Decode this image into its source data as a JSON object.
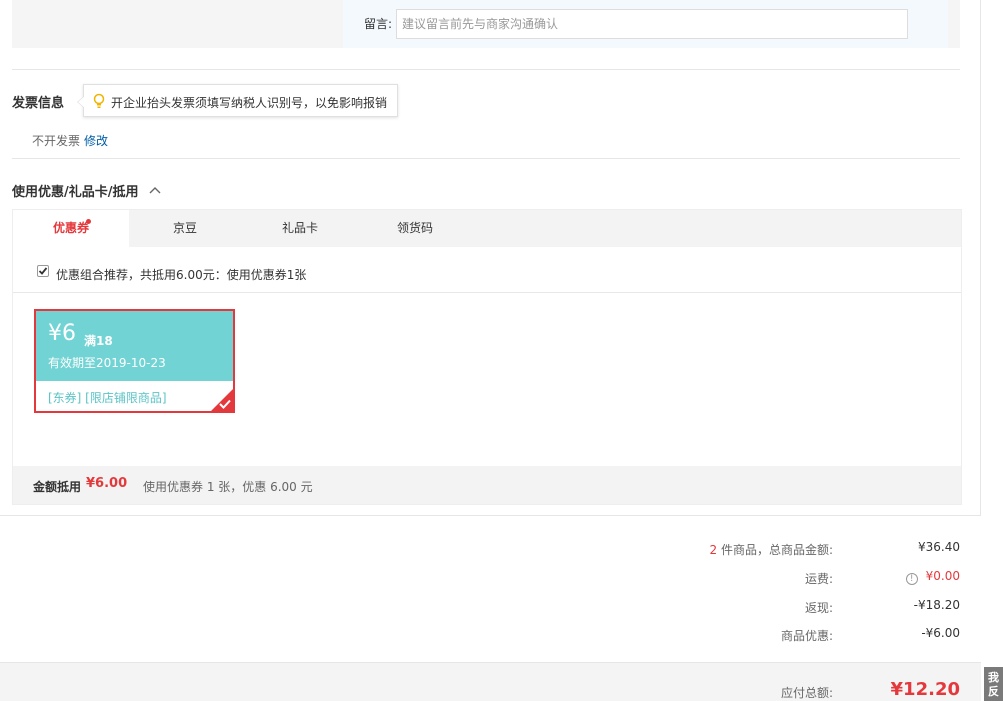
{
  "remark": {
    "label": "留言:",
    "placeholder": "建议留言前先与商家沟通确认"
  },
  "invoice": {
    "title": "发票信息",
    "tip_icon": "lightbulb-icon",
    "tip": "开企业抬头发票须填写纳税人识别号，以免影响报销",
    "status": "不开发票",
    "edit_label": "修改"
  },
  "discount": {
    "title": "使用优惠/礼品卡/抵用",
    "toggle_icon": "chevron-up-icon",
    "tabs": [
      {
        "label": "优惠券",
        "active": true,
        "has_dot": true
      },
      {
        "label": "京豆",
        "active": false
      },
      {
        "label": "礼品卡",
        "active": false
      },
      {
        "label": "领货码",
        "active": false
      }
    ],
    "combo_checked": true,
    "combo_text": "优惠组合推荐，共抵用6.00元：使用优惠券1张",
    "coupon": {
      "amount": "¥6",
      "condition": "满18",
      "expiry": "有效期至2019-10-23",
      "tags": "[东券]  [限店铺限商品]",
      "selected": true
    },
    "footer": {
      "label": "金额抵用",
      "amount": "¥6.00",
      "desc": "使用优惠券 1 张，优惠 6.00 元"
    }
  },
  "summary": {
    "item_count": "2",
    "item_label": " 件商品，总商品金额:",
    "item_total": "¥36.40",
    "shipping_label": "运费:",
    "shipping_value": "¥0.00",
    "cashback_label": "返现:",
    "cashback_value": "-¥18.20",
    "discount_label": "商品优惠:",
    "discount_value": "-¥6.00",
    "total_label": "应付总额:",
    "total_value": "¥12.20"
  },
  "feedback": {
    "label": "我反"
  },
  "colors": {
    "accent_red": "#e4393c",
    "coupon_teal": "#72d3d4",
    "link_blue": "#005ea7"
  }
}
